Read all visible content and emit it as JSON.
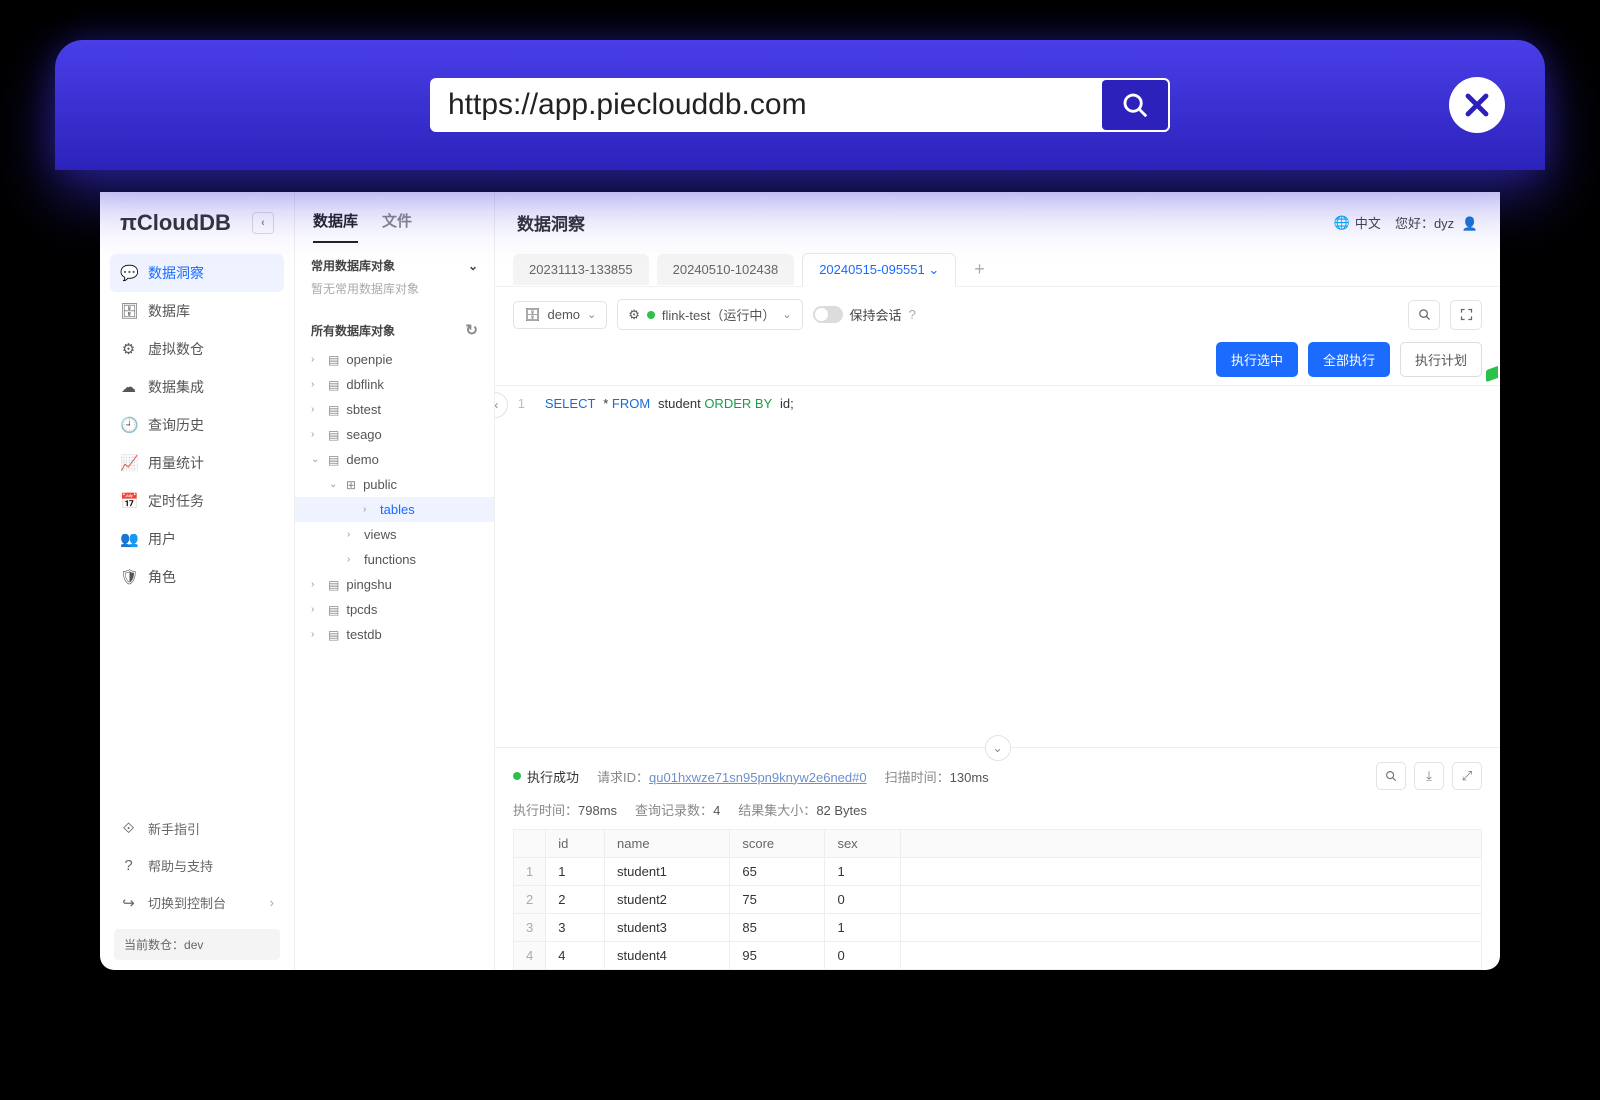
{
  "browser": {
    "url": "https://app.pieclouddb.com"
  },
  "logo": "πCloudDB",
  "header": {
    "title": "数据洞察",
    "lang": "中文",
    "greeting": "您好：",
    "user": "dyz"
  },
  "nav": {
    "items": [
      {
        "icon": "💬",
        "label": "数据洞察",
        "active": true
      },
      {
        "icon": "🗄",
        "label": "数据库"
      },
      {
        "icon": "⚙",
        "label": "虚拟数仓"
      },
      {
        "icon": "☁",
        "label": "数据集成"
      },
      {
        "icon": "🕘",
        "label": "查询历史"
      },
      {
        "icon": "📈",
        "label": "用量统计"
      },
      {
        "icon": "📅",
        "label": "定时任务"
      },
      {
        "icon": "👥",
        "label": "用户"
      },
      {
        "icon": "🛡",
        "label": "角色"
      }
    ],
    "footer": [
      {
        "icon": "⟐",
        "label": "新手指引"
      },
      {
        "icon": "?",
        "label": "帮助与支持"
      },
      {
        "icon": "↪",
        "label": "切换到控制台",
        "chev": true
      }
    ],
    "current_dw_label": "当前数仓：",
    "current_dw_value": "dev"
  },
  "dbpanel": {
    "tabs": [
      "数据库",
      "文件"
    ],
    "section_common": "常用数据库对象",
    "section_common_empty": "暂无常用数据库对象",
    "section_all": "所有数据库对象",
    "databases": [
      "openpie",
      "dbflink",
      "sbtest",
      "seago",
      "demo",
      "pingshu",
      "tpcds",
      "testdb"
    ],
    "expanded_db": "demo",
    "expanded_schema": "public",
    "schema_children": [
      "tables",
      "views",
      "functions"
    ],
    "selected_node": "tables"
  },
  "editor_tabs": [
    "20231113-133855",
    "20240510-102438",
    "20240515-095551"
  ],
  "editor_tab_active": 2,
  "toolbar": {
    "db_selector": "demo",
    "vw_selector": "flink-test（运行中）",
    "keep_session": "保持会话"
  },
  "action_buttons": {
    "run_selected": "执行选中",
    "run_all": "全部执行",
    "plan": "执行计划"
  },
  "sql": {
    "line": "1",
    "kw_select": "SELECT",
    "star": "*",
    "kw_from": "FROM",
    "table": "student",
    "kw_orderby": "ORDER BY",
    "col": "id;"
  },
  "results": {
    "status": "执行成功",
    "request_label": "请求ID：",
    "request_id": "qu01hxwze71sn95pn9knyw2e6ned#0",
    "scan_label": "扫描时间：",
    "scan_value": "130ms",
    "exec_label": "执行时间：",
    "exec_value": "798ms",
    "count_label": "查询记录数：",
    "count_value": "4",
    "size_label": "结果集大小：",
    "size_value": "82 Bytes",
    "columns": [
      "id",
      "name",
      "score",
      "sex"
    ],
    "rows": [
      [
        "1",
        "student1",
        "65",
        "1"
      ],
      [
        "2",
        "student2",
        "75",
        "0"
      ],
      [
        "3",
        "student3",
        "85",
        "1"
      ],
      [
        "4",
        "student4",
        "95",
        "0"
      ]
    ]
  }
}
